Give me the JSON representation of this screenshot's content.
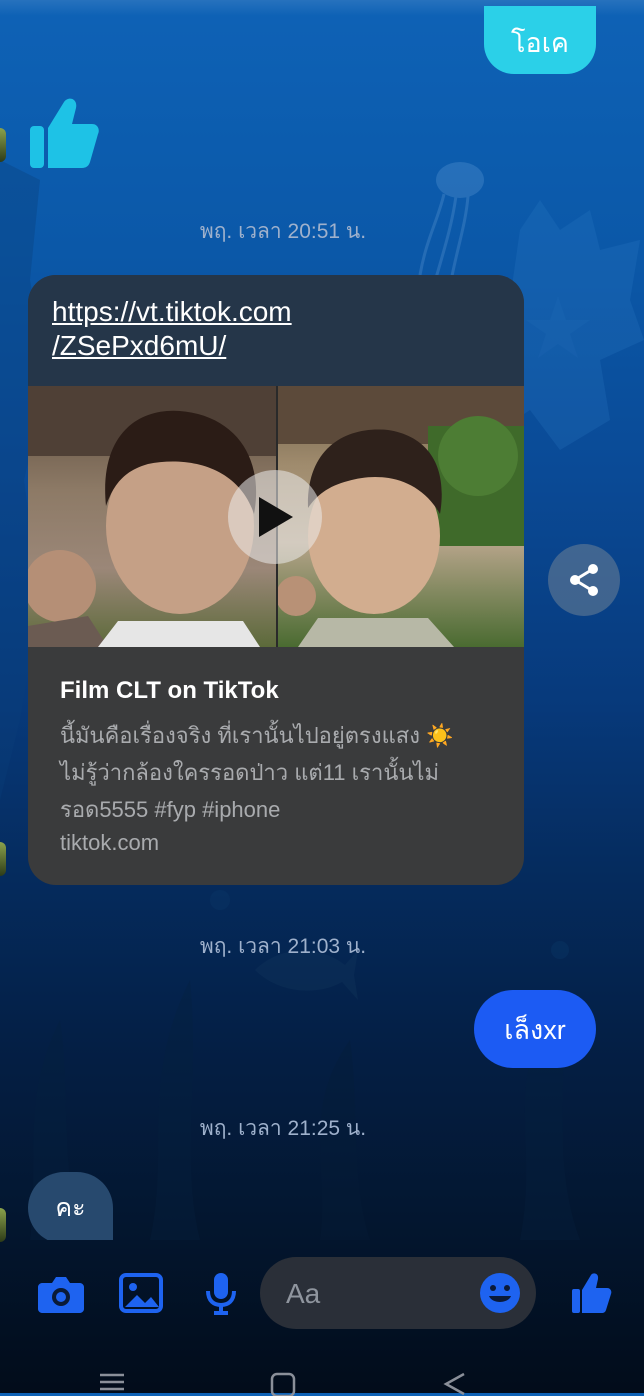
{
  "messages": {
    "ok_text": "โอเค",
    "ts1": "พฤ. เวลา 20:51 น.",
    "ts2": "พฤ. เวลา 21:03 น.",
    "ts3": "พฤ. เวลา 21:25 น.",
    "leng_text": "เล็งxr",
    "ka_text": "คะ"
  },
  "link_card": {
    "url_line1": "https://vt.tiktok.com",
    "url_line2": "/ZSePxd6mU/",
    "title": "Film CLT on TikTok",
    "desc_line1": "นี้มันคือเรื่องจริง ที่เรานั้นไปอยู่ตรงแสง ☀️",
    "desc_line2": "ไม่รู้ว่ากล้องใครรอดป่าว แต่11 เรานั้นไม่",
    "desc_line3": "รอด5555 #fyp #iphone",
    "domain": "tiktok.com"
  },
  "composer": {
    "placeholder": "Aa"
  },
  "icons": {
    "camera": "camera-icon",
    "gallery": "image-icon",
    "mic": "microphone-icon",
    "emoji": "emoji-icon",
    "like": "thumbs-up-icon",
    "share": "share-icon",
    "play": "play-icon"
  },
  "colors": {
    "accent": "#1c5bf3",
    "bubble_cyan": "#2bd0e8",
    "icon_blue": "#1e63f0"
  }
}
